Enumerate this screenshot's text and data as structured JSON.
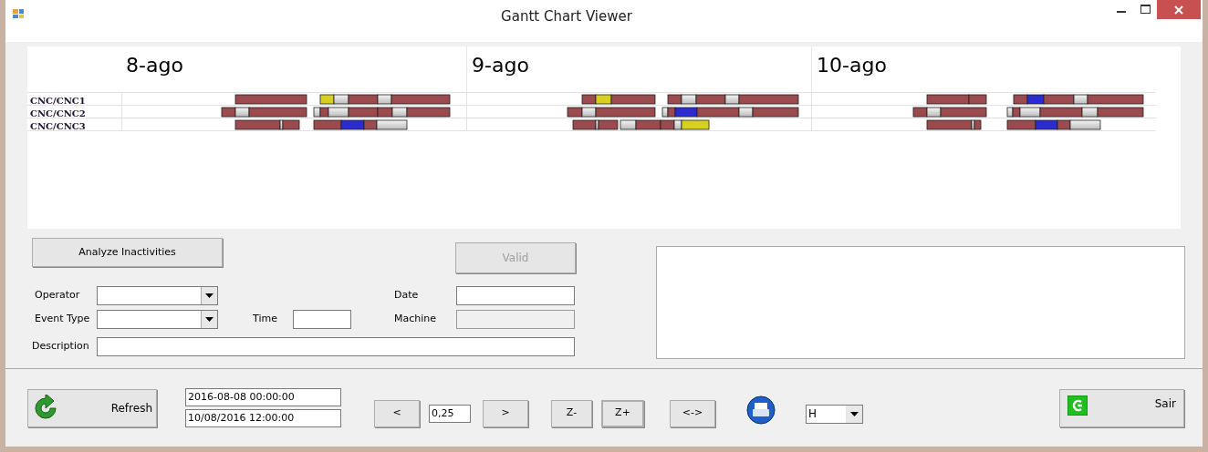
{
  "window": {
    "title": "Gantt Chart Viewer"
  },
  "gantt": {
    "days": [
      "8-ago",
      "9-ago",
      "10-ago"
    ],
    "machines": [
      "CNC/CNC1",
      "CNC/CNC2",
      "CNC/CNC3"
    ]
  },
  "form": {
    "analyze_button": "Analyze Inactivities",
    "valid_button": {
      "label": "Valid",
      "disabled": true
    },
    "operator": {
      "label": "Operator"
    },
    "event_type": {
      "label": "Event Type"
    },
    "time": {
      "label": "Time"
    },
    "date": {
      "label": "Date"
    },
    "machine": {
      "label": "Machine",
      "disabled": true
    },
    "description": {
      "label": "Description"
    }
  },
  "toolbar": {
    "refresh": "Refresh",
    "start": "2016-08-08 00:00:00",
    "end": "10/08/2016 12:00:00",
    "prev": "<",
    "step": "0,25",
    "next": ">",
    "zoom_out": "Z-",
    "zoom_in": {
      "label": "Z+",
      "focused": true
    },
    "fit": "<->",
    "unit": "H",
    "exit": "Sair"
  }
}
